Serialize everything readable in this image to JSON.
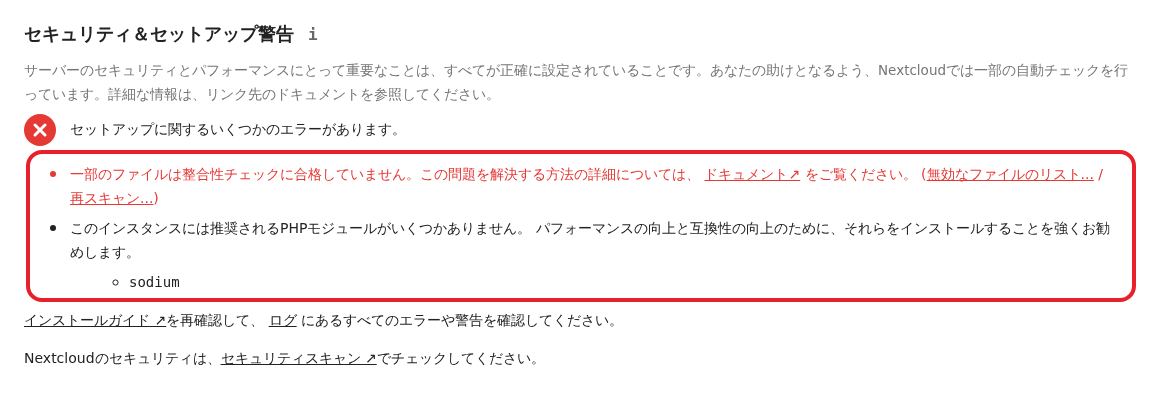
{
  "title": "セキュリティ＆セットアップ警告",
  "info_icon": "i",
  "description": "サーバーのセキュリティとパフォーマンスにとって重要なことは、すべてが正確に設定されていることです。あなたの助けとなるよう、Nextcloudでは一部の自動チェックを行っています。詳細な情報は、リンク先のドキュメントを参照してください。",
  "status": {
    "kind": "error",
    "text": "セットアップに関するいくつかのエラーがあります。"
  },
  "issues": [
    {
      "kind": "error",
      "segments": [
        {
          "kind": "text",
          "text": "一部のファイルは整合性チェックに合格していません。この問題を解決する方法の詳細については、 "
        },
        {
          "kind": "link",
          "text": "ドキュメント↗"
        },
        {
          "kind": "text",
          "text": " をご覧ください。 ("
        },
        {
          "kind": "link",
          "text": "無効なファイルのリスト..."
        },
        {
          "kind": "text",
          "text": " / "
        },
        {
          "kind": "link",
          "text": "再スキャン..."
        },
        {
          "kind": "text",
          "text": ")"
        }
      ]
    },
    {
      "kind": "warning",
      "segments": [
        {
          "kind": "text",
          "text": "このインスタンスには推奨されるPHPモジュールがいくつかありません。 パフォーマンスの向上と互換性の向上のために、それらをインストールすることを強くお勧めします。"
        }
      ],
      "children": [
        "sodium"
      ]
    }
  ],
  "footer": [
    [
      {
        "kind": "link",
        "text": "インストールガイド ↗"
      },
      {
        "kind": "text",
        "text": "を再確認して、 "
      },
      {
        "kind": "link",
        "text": "ログ"
      },
      {
        "kind": "text",
        "text": " にあるすべてのエラーや警告を確認してください。"
      }
    ],
    [
      {
        "kind": "text",
        "text": "Nextcloudのセキュリティは、"
      },
      {
        "kind": "link",
        "text": "セキュリティスキャン ↗"
      },
      {
        "kind": "text",
        "text": "でチェックしてください。"
      }
    ]
  ]
}
